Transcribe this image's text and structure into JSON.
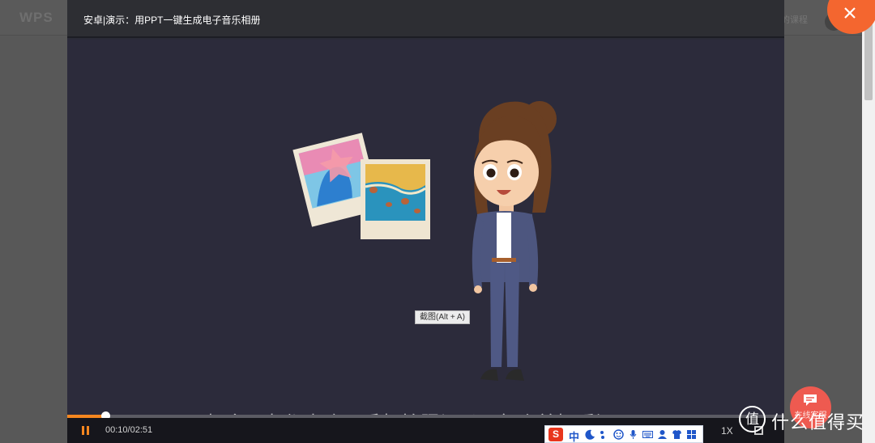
{
  "background": {
    "logo": "WPS",
    "link": "的课程"
  },
  "modal": {
    "title": "安卓|演示：用PPT一键生成电子音乐相册"
  },
  "video": {
    "tooltip": "截图(Alt + A)",
    "subtitle": "好多朋友都喜欢用手机拍照记录下每个美好瞬间",
    "progress": 0.059,
    "colors": {
      "accent": "#f5861f",
      "background": "#2c2b3b",
      "close": "#f4662f"
    }
  },
  "controls": {
    "time": "00:10/02:51",
    "speed": "1X",
    "pause_icon": "pause-icon",
    "fullscreen_icon": "fullscreen-icon"
  },
  "ime": {
    "logo": "S",
    "mode": "中"
  },
  "chat": {
    "label": "在线客服"
  },
  "watermark": {
    "badge": "值",
    "text": "什么值得买"
  }
}
